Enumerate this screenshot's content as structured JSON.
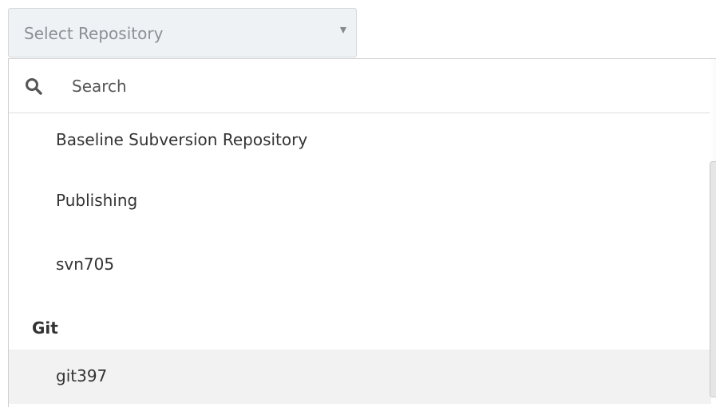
{
  "select": {
    "placeholder": "Select Repository"
  },
  "search": {
    "placeholder": "Search",
    "value": ""
  },
  "options": [
    {
      "label": "Baseline Subversion Repository"
    },
    {
      "label": "Publishing"
    },
    {
      "label": "svn705"
    }
  ],
  "groups": [
    {
      "label": "Git",
      "items": [
        {
          "label": "git397",
          "highlighted": true
        }
      ]
    }
  ],
  "colors": {
    "select_background": "#eef2f4",
    "select_border": "#d3d9dd",
    "highlight_row": "#f2f2f2",
    "text": "#333333",
    "muted_text": "#8a9196"
  },
  "icons": {
    "search": "search-icon",
    "caret": "caret-down-icon"
  }
}
